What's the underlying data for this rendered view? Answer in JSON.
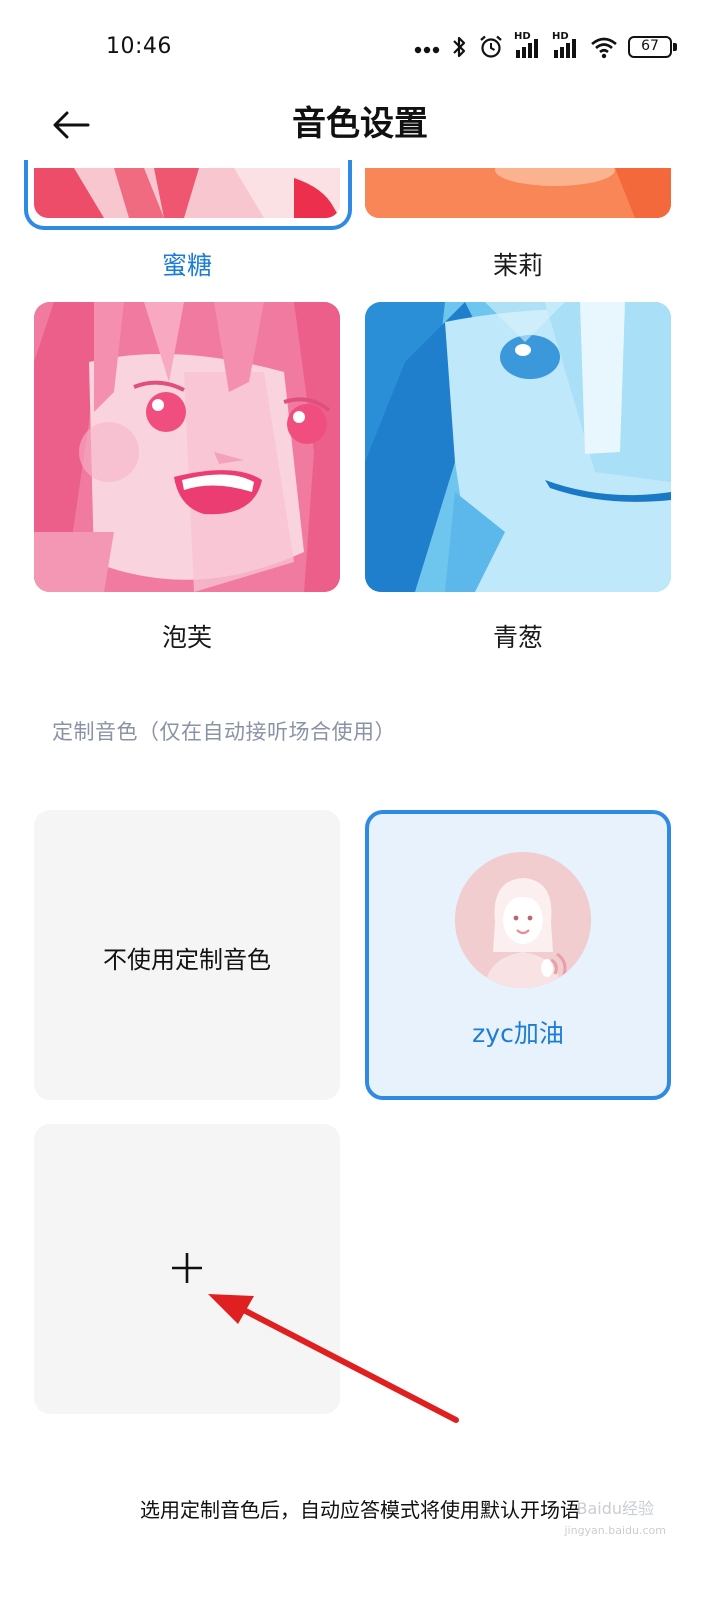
{
  "status_bar": {
    "time": "10:46",
    "icons": [
      "more-dots-icon",
      "bluetooth-icon",
      "alarm-icon",
      "hd-signal-icon",
      "hd-signal-icon",
      "wifi-icon",
      "battery-icon"
    ],
    "hd_label": "HD",
    "battery_level": "67"
  },
  "header": {
    "title": "音色设置",
    "back_icon": "back-arrow-icon"
  },
  "voices": [
    {
      "label": "蜜糖",
      "selected": true
    },
    {
      "label": "茉莉",
      "selected": false
    },
    {
      "label": "泡芙",
      "selected": false
    },
    {
      "label": "青葱",
      "selected": false
    }
  ],
  "custom_section": {
    "title": "定制音色（仅在自动接听场合使用）",
    "no_custom_label": "不使用定制音色",
    "custom_voice_name": "zyc加油",
    "add_icon": "plus-icon"
  },
  "footer": {
    "note": "选用定制音色后，自动应答模式将使用默认开场语"
  },
  "watermark": {
    "text": "Baidu经验",
    "sub": "jingyan.baidu.com"
  },
  "colors": {
    "accent": "#2f8ae3",
    "selected_text": "#1d7dd6",
    "tile_bg": "#f5f5f5",
    "annotation_arrow": "#e02020"
  }
}
